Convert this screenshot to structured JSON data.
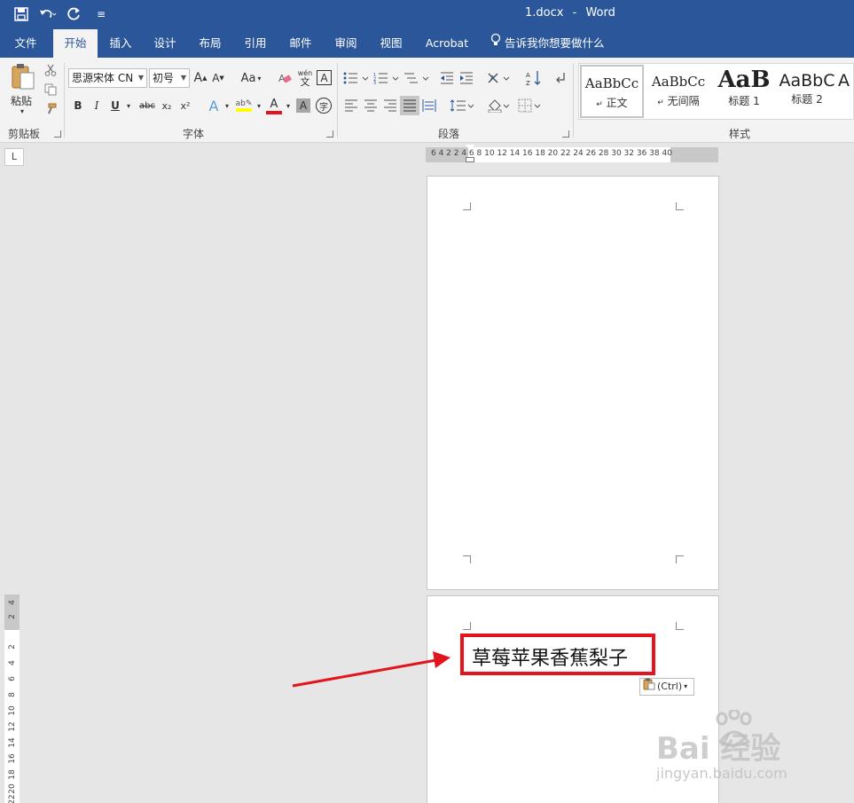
{
  "titlebar": {
    "doc_name": "1.docx",
    "separator": "-",
    "app_name": "Word",
    "customize_glyph": "≡"
  },
  "tabs": [
    {
      "label": "文件",
      "active": false
    },
    {
      "label": "开始",
      "active": true
    },
    {
      "label": "插入",
      "active": false
    },
    {
      "label": "设计",
      "active": false
    },
    {
      "label": "布局",
      "active": false
    },
    {
      "label": "引用",
      "active": false
    },
    {
      "label": "邮件",
      "active": false
    },
    {
      "label": "审阅",
      "active": false
    },
    {
      "label": "视图",
      "active": false
    },
    {
      "label": "Acrobat",
      "active": false
    }
  ],
  "tell_me": "告诉我你想要做什么",
  "clipboard": {
    "paste_label": "粘贴",
    "group_label": "剪贴板"
  },
  "font": {
    "font_name": "思源宋体 CN",
    "font_size": "初号",
    "bold": "B",
    "italic": "I",
    "underline": "U",
    "strike": "abc",
    "sub": "x₂",
    "sup": "x²",
    "grow": "A",
    "shrink": "A",
    "case": "Aa",
    "phonetic": "wén",
    "phonetic_char": "文",
    "border_char": "A",
    "char_shade": "A",
    "enclose": "字",
    "group_label": "字体",
    "highlight_color": "#ffff00",
    "font_color": "#e3141d"
  },
  "paragraph": {
    "group_label": "段落"
  },
  "styles": {
    "items": [
      {
        "sample": "AaBbCc",
        "name": "正文",
        "selected": true
      },
      {
        "sample": "AaBbCc",
        "name": "无间隔",
        "selected": false
      },
      {
        "sample": "AaB",
        "name": "标题 1",
        "selected": false
      },
      {
        "sample": "AaBbC",
        "name": "标题 2",
        "selected": false
      },
      {
        "sample": "A",
        "name": "",
        "selected": false
      }
    ],
    "group_label": "样式"
  },
  "ruler": {
    "corner": "L",
    "h_numbers": "6  4  2        2   4   6   8  10 12 14 16 18 20 22 24 26 28 30 32      36 38 40",
    "v_numbers": [
      "4",
      "2",
      "2",
      "4",
      "6",
      "8",
      "10",
      "12",
      "14",
      "16",
      "18",
      "20",
      "22"
    ]
  },
  "document": {
    "text": "草莓苹果香蕉梨子",
    "paste_options": "(Ctrl)"
  },
  "watermark": {
    "main": "Bai 经验",
    "sub": "jingyan.baidu.com"
  },
  "colors": {
    "accent": "#2b579a",
    "annotation": "#e3141d"
  }
}
